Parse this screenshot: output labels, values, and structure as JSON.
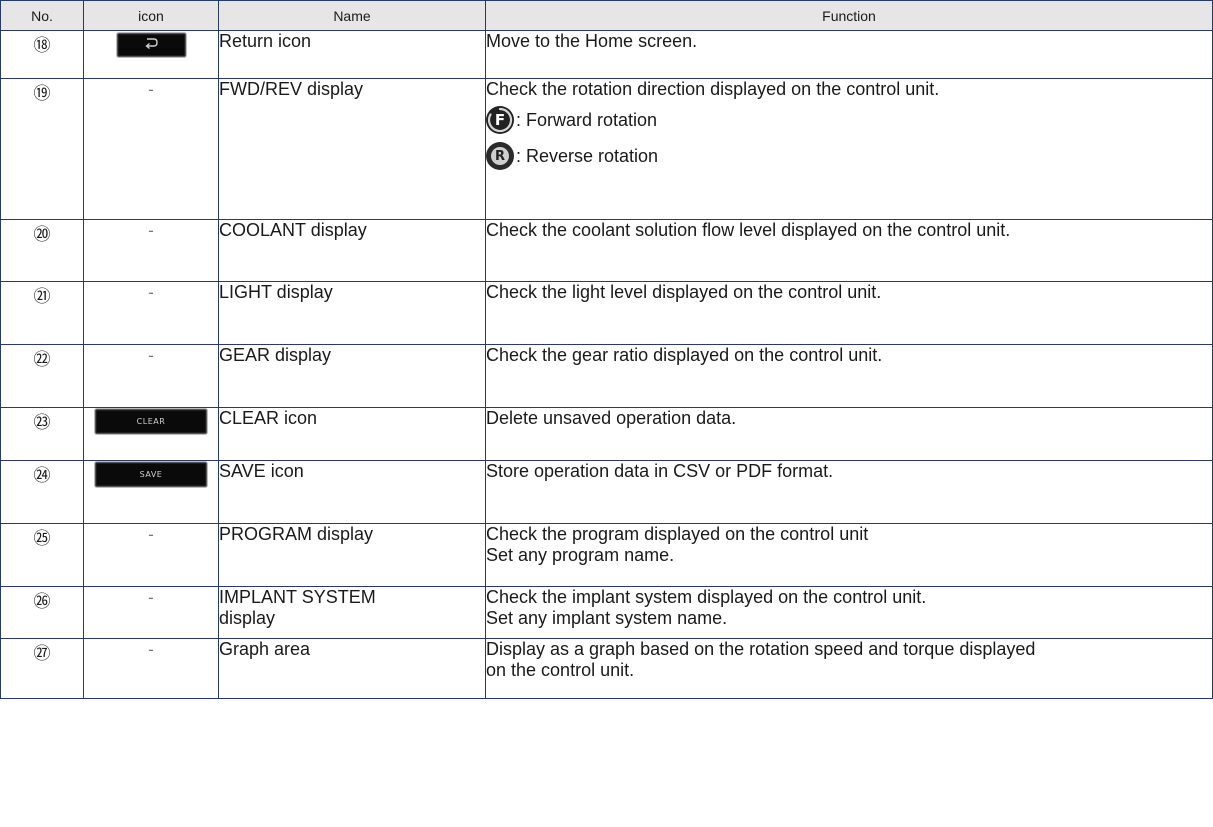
{
  "header": {
    "no": "No.",
    "icon": "icon",
    "name": "Name",
    "function": "Function"
  },
  "rows": [
    {
      "no": "⑱",
      "icon_text": "",
      "name": "Return icon",
      "function": "Move to the Home screen."
    },
    {
      "no": "⑲",
      "icon_text": "-",
      "name": "FWD/REV display",
      "function": "Check the rotation direction displayed on the control unit.",
      "sub": [
        {
          "icon": "forward-rotation-icon",
          "letter": "F",
          "label": ": Forward rotation"
        },
        {
          "icon": "reverse-rotation-icon",
          "letter": "R",
          "label": ": Reverse rotation"
        }
      ]
    },
    {
      "no": "⑳",
      "icon_text": "-",
      "name": "COOLANT display",
      "function": "Check the coolant solution flow level displayed on the control unit."
    },
    {
      "no": "㉑",
      "icon_text": "-",
      "name": "LIGHT display",
      "function": "Check the light level displayed on the control unit."
    },
    {
      "no": "㉒",
      "icon_text": "-",
      "name": "GEAR display",
      "function": "Check the gear ratio displayed on the control unit."
    },
    {
      "no": "㉓",
      "icon_text": "CLEAR",
      "name": "CLEAR icon",
      "function": "Delete unsaved operation data."
    },
    {
      "no": "㉔",
      "icon_text": "SAVE",
      "name": "SAVE icon",
      "function": "Store operation data in CSV or PDF format."
    },
    {
      "no": "㉕",
      "icon_text": "-",
      "name": "PROGRAM display",
      "function": [
        "Check the program displayed on the control unit",
        "Set any program name."
      ]
    },
    {
      "no": "㉖",
      "icon_text": "-",
      "name": [
        "IMPLANT SYSTEM",
        "display"
      ],
      "function": [
        "Check the implant system displayed on the control unit.",
        "Set any implant system name."
      ]
    },
    {
      "no": "㉗",
      "icon_text": "-",
      "name": "Graph area",
      "function": [
        "Display as a graph based on the rotation speed and torque displayed",
        "on the control unit."
      ]
    }
  ],
  "colors": {
    "border": "#2a3b63",
    "header_bg": "#e6e6e6",
    "button_bg": "#0a0a0a"
  }
}
